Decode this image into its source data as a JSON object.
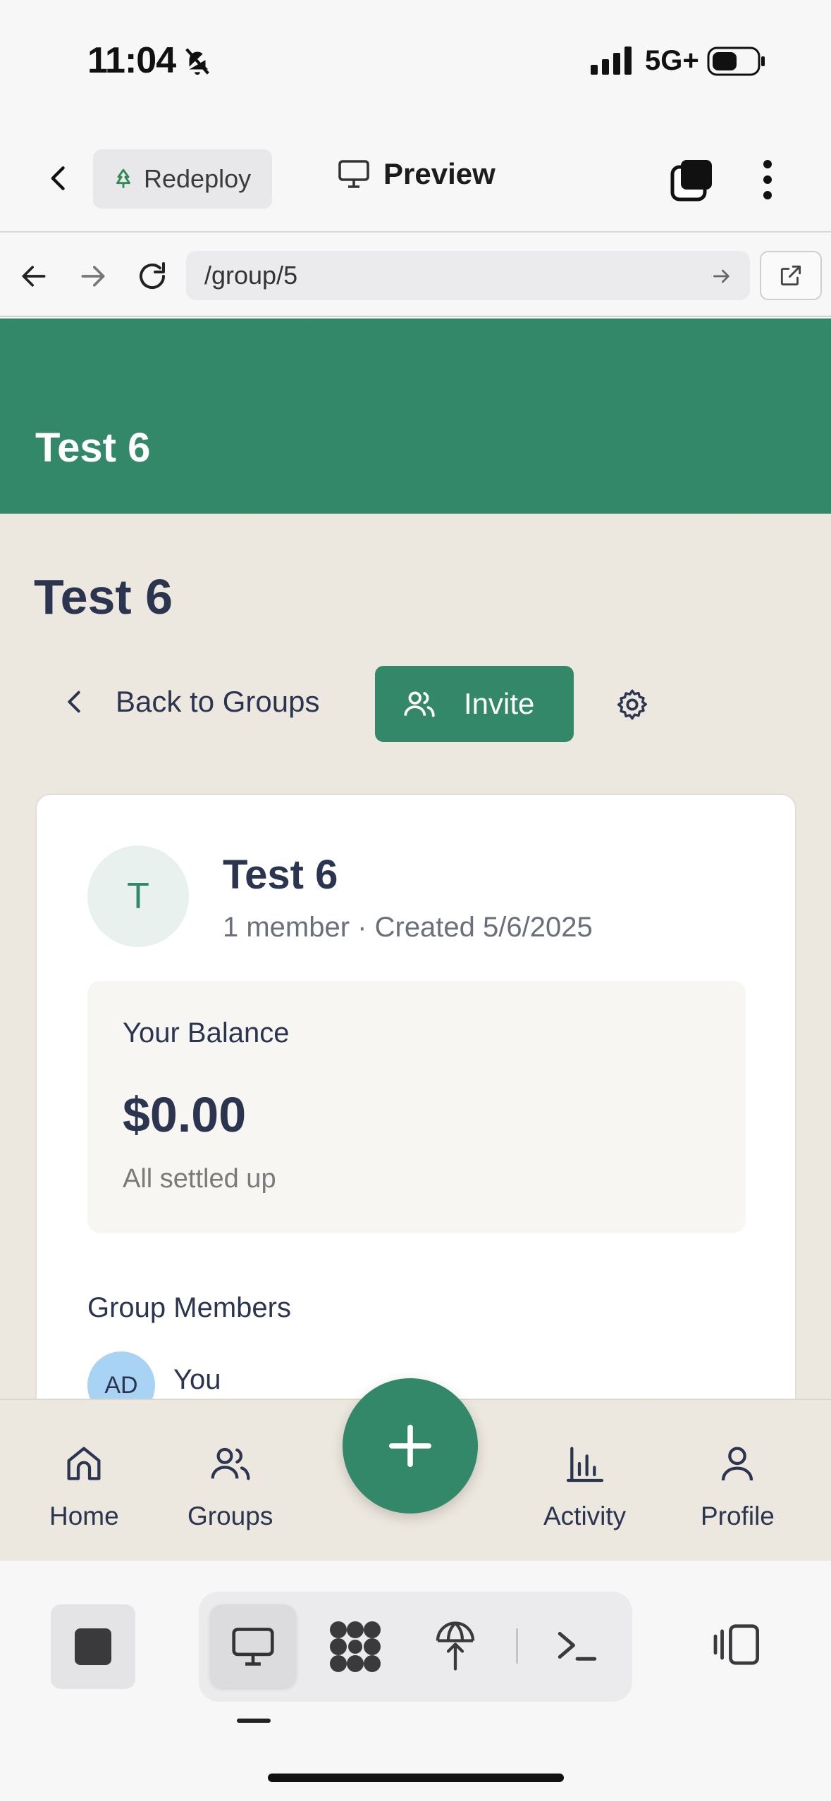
{
  "status_bar": {
    "time": "11:04",
    "network": "5G+"
  },
  "toolbar": {
    "redeploy_label": "Redeploy",
    "preview_label": "Preview"
  },
  "browser": {
    "url": "/group/5"
  },
  "app": {
    "header_title": "Test 6",
    "page_title": "Test 6",
    "back_label": "Back to Groups",
    "invite_label": "Invite",
    "group": {
      "initial": "T",
      "name": "Test 6",
      "meta": "1 member · Created 5/6/2025"
    },
    "balance": {
      "label": "Your Balance",
      "amount": "$0.00",
      "status": "All settled up"
    },
    "members": {
      "title": "Group Members",
      "items": [
        {
          "initials": "AD",
          "name": "You"
        }
      ]
    },
    "colors": {
      "brand_green": "#34886a",
      "background_beige": "#ede8df",
      "text_navy": "#2b3550"
    }
  },
  "bottom_nav": {
    "items": [
      {
        "label": "Home",
        "icon": "home-icon"
      },
      {
        "label": "Groups",
        "icon": "users-icon"
      },
      {
        "label": "Activity",
        "icon": "bar-chart-icon"
      },
      {
        "label": "Profile",
        "icon": "user-icon"
      }
    ],
    "fab_icon": "plus-icon"
  },
  "system_toolbar": {
    "icons": [
      "stop-icon",
      "desktop-icon",
      "grid-blob-icon",
      "deploy-icon",
      "terminal-icon",
      "panel-icon"
    ]
  }
}
